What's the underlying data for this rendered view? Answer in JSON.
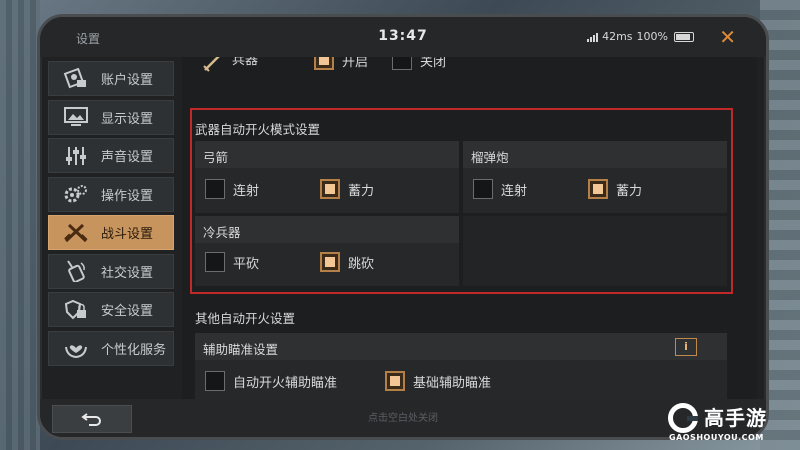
{
  "window": {
    "title": "设置",
    "time": "13:47",
    "ping": "42ms",
    "battery": "100%"
  },
  "sidebar": {
    "items": [
      {
        "label": "账户设置",
        "icon": "account-icon"
      },
      {
        "label": "显示设置",
        "icon": "display-icon"
      },
      {
        "label": "声音设置",
        "icon": "sound-sliders-icon"
      },
      {
        "label": "操作设置",
        "icon": "gears-icon"
      },
      {
        "label": "战斗设置",
        "icon": "crossed-weapons-icon",
        "active": true
      },
      {
        "label": "社交设置",
        "icon": "walkie-talkie-icon"
      },
      {
        "label": "安全设置",
        "icon": "shield-lock-icon"
      },
      {
        "label": "个性化服务",
        "icon": "heart-hands-icon"
      }
    ]
  },
  "main": {
    "partial_row": {
      "label": "兵器",
      "options": [
        "开启",
        "关闭"
      ]
    },
    "auto_fire_section": {
      "title": "武器自动开火模式设置",
      "bow": {
        "title": "弓箭",
        "options": [
          {
            "label": "连射",
            "checked": false
          },
          {
            "label": "蓄力",
            "checked": true
          }
        ]
      },
      "grenade": {
        "title": "榴弹炮",
        "options": [
          {
            "label": "连射",
            "checked": false
          },
          {
            "label": "蓄力",
            "checked": true
          }
        ]
      },
      "melee": {
        "title": "冷兵器",
        "options": [
          {
            "label": "平砍",
            "checked": false
          },
          {
            "label": "跳砍",
            "checked": true
          }
        ]
      }
    },
    "other_section": {
      "title": "其他自动开火设置",
      "aim_assist": {
        "title": "辅助瞄准设置",
        "info_label": "i",
        "options": [
          {
            "label": "自动开火辅助瞄准",
            "checked": false
          },
          {
            "label": "基础辅助瞄准",
            "checked": true
          }
        ]
      }
    }
  },
  "bottom": {
    "hint": "点击空白处关闭"
  },
  "watermark": {
    "brand": "高手游",
    "domain": "GAOSHOUYOU.COM"
  },
  "colors": {
    "accent": "#c7945d",
    "highlight_box": "#c0282a",
    "close": "#e08a3c"
  }
}
